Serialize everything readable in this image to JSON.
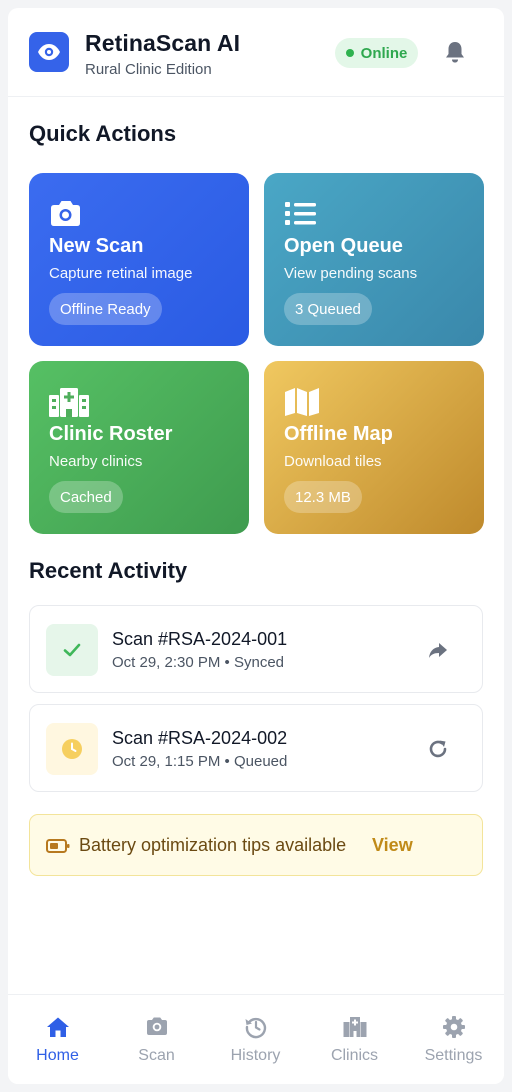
{
  "header": {
    "title": "RetinaScan AI",
    "subtitle": "Rural Clinic Edition",
    "status": "Online",
    "logo_icon": "eye-icon",
    "notification_icon": "bell-icon"
  },
  "quick_actions": {
    "title": "Quick Actions",
    "cards": [
      {
        "title": "New Scan",
        "subtitle": "Capture retinal image",
        "badge": "Offline Ready",
        "icon": "camera-icon"
      },
      {
        "title": "Open Queue",
        "subtitle": "View pending scans",
        "badge": "3 Queued",
        "icon": "list-icon"
      },
      {
        "title": "Clinic Roster",
        "subtitle": "Nearby clinics",
        "badge": "Cached",
        "icon": "hospital-icon"
      },
      {
        "title": "Offline Map",
        "subtitle": "Download tiles",
        "badge": "12.3 MB",
        "icon": "map-icon"
      }
    ]
  },
  "recent_activity": {
    "title": "Recent Activity",
    "items": [
      {
        "title": "Scan #RSA-2024-001",
        "meta": "Oct 29, 2:30 PM • Synced",
        "status_icon": "check-icon",
        "action_icon": "share-icon"
      },
      {
        "title": "Scan #RSA-2024-002",
        "meta": "Oct 29, 1:15 PM • Queued",
        "status_icon": "clock-icon",
        "action_icon": "retry-icon"
      }
    ]
  },
  "tip": {
    "text": "Battery optimization tips available",
    "link": "View",
    "icon": "battery-icon"
  },
  "nav": {
    "items": [
      {
        "label": "Home",
        "icon": "home-icon",
        "active": true
      },
      {
        "label": "Scan",
        "icon": "camera-icon"
      },
      {
        "label": "History",
        "icon": "history-icon"
      },
      {
        "label": "Clinics",
        "icon": "clinic-icon"
      },
      {
        "label": "Settings",
        "icon": "gear-icon"
      }
    ]
  },
  "colors": {
    "primary": "#3563e9",
    "online": "#2fa84f",
    "queue": "#4aa7c6",
    "roster": "#56c064",
    "map": "#d9a83e",
    "tip_bg": "#fffbe6"
  }
}
